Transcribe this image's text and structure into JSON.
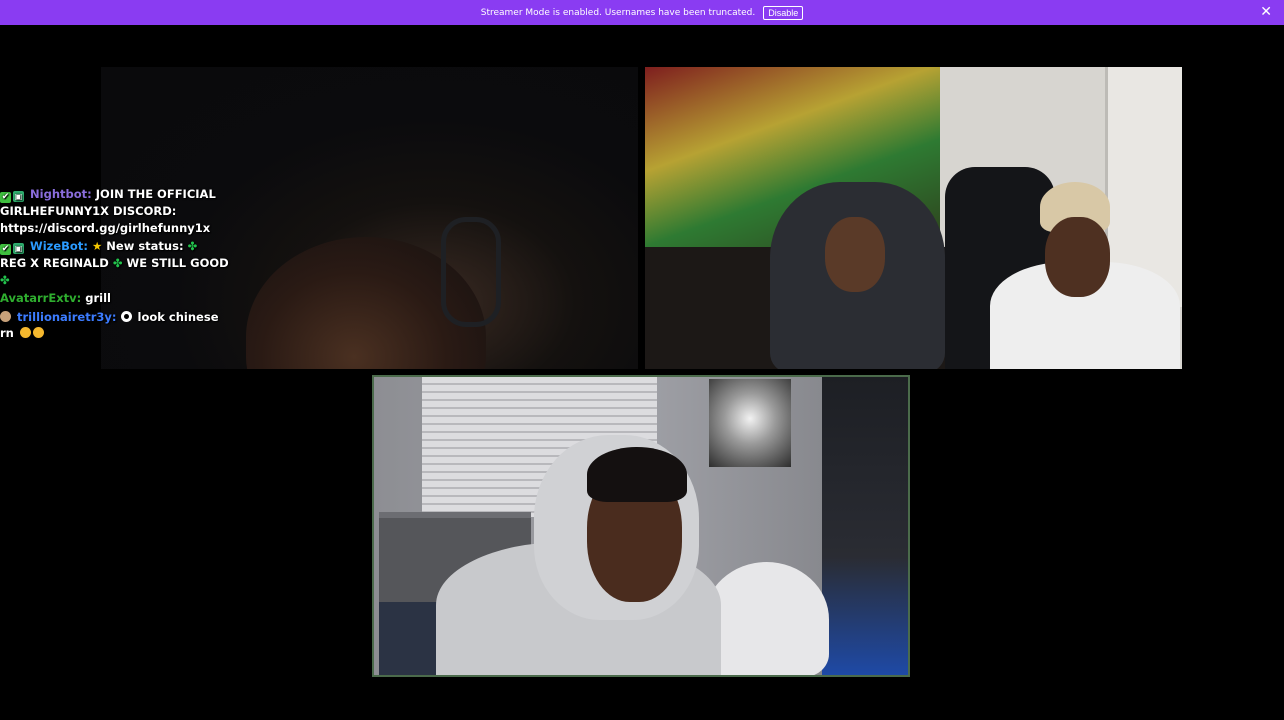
{
  "banner": {
    "message": "Streamer Mode is enabled. Usernames have been truncated.",
    "disable_label": "Disable",
    "close_glyph": "✕",
    "color": "#8a3cf2"
  },
  "chat": {
    "messages": [
      {
        "badges": [
          "verified-check-badge",
          "bot-badge"
        ],
        "username": "Nightbot",
        "username_color": "#8a6ddc",
        "text_lines": [
          "JOIN THE OFFICIAL",
          "GIRLHEFUNNY1X DISCORD:",
          "https://discord.gg/girlhefunny1x"
        ]
      },
      {
        "badges": [
          "verified-check-badge",
          "bot-badge"
        ],
        "username": "WizeBot",
        "username_color": "#2b9bff",
        "text_pre": "New status:",
        "text_line2": "REG X REGINALD",
        "text_line2b": "WE STILL GOOD"
      },
      {
        "username": "AvatarrExtv",
        "username_color": "#2fae2f",
        "text": "grill"
      },
      {
        "badges": [
          "avatar-badge"
        ],
        "username": "trillionairetr3y",
        "username_color": "#3c7cff",
        "text": "look chinese",
        "text_line2": "rn"
      }
    ]
  },
  "tiles": [
    {
      "name": "streamer-webcam-top-left"
    },
    {
      "name": "streamer-webcam-top-right"
    },
    {
      "name": "streamer-webcam-bottom-center"
    }
  ]
}
